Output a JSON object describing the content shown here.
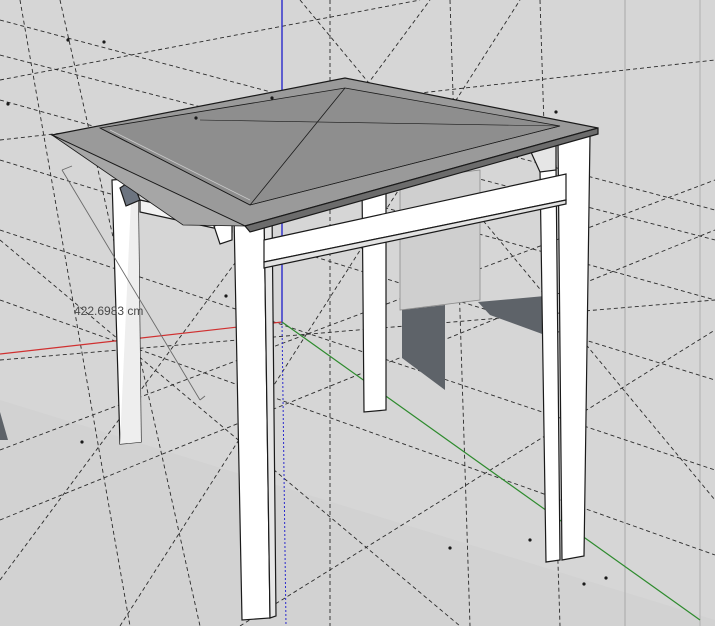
{
  "viewport": {
    "dimension_label": "422.6983 cm",
    "colors": {
      "background": "#d8d8d8",
      "guide": "#2b2b2b",
      "axis_red": "#d03030",
      "axis_green": "#2e8b2e",
      "axis_blue": "#2a2acc",
      "roof": "#9a9a9a",
      "roof_dark": "#6c6c6c",
      "post": "#ffffff",
      "post_shadow": "#e6e6e6",
      "shadow": "#5e6369",
      "edge": "#1a1a1a"
    }
  }
}
